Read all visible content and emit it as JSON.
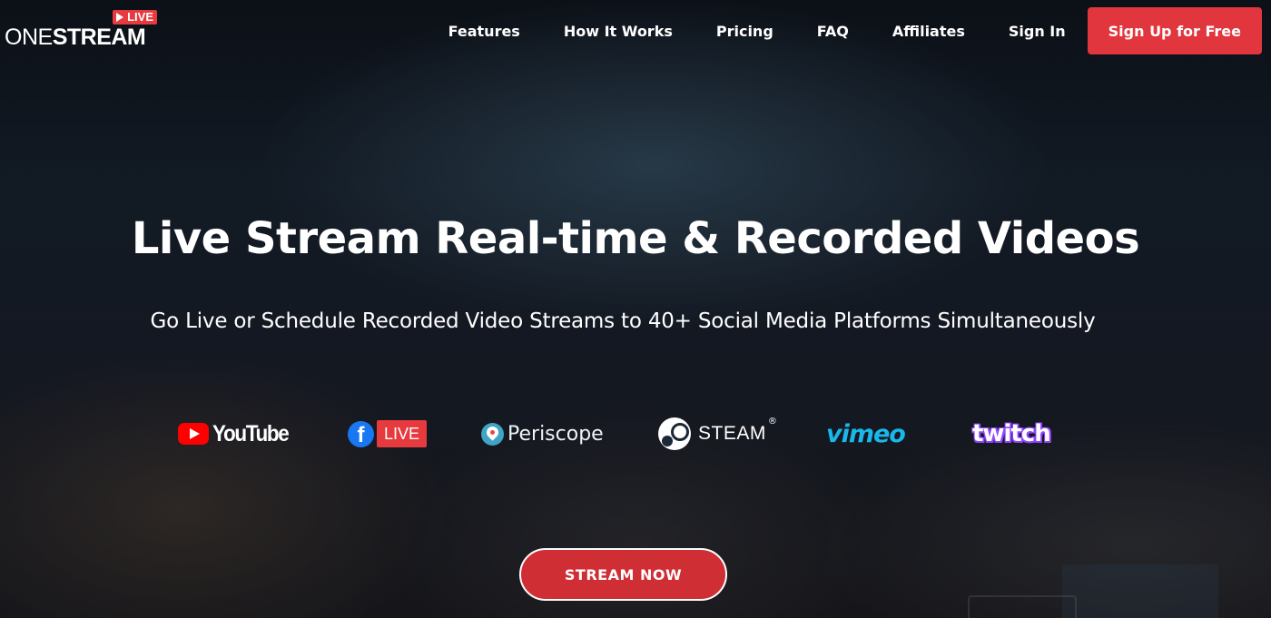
{
  "header": {
    "logo": {
      "badge": "LIVE",
      "word_one": "ONE",
      "word_stream": "STREAM"
    },
    "nav": [
      {
        "label": "Features"
      },
      {
        "label": "How It Works"
      },
      {
        "label": "Pricing"
      },
      {
        "label": "FAQ"
      },
      {
        "label": "Affiliates"
      },
      {
        "label": "Sign In"
      }
    ],
    "signup_label": "Sign Up for Free"
  },
  "hero": {
    "title": "Live Stream Real-time & Recorded Videos",
    "subtitle": "Go Live or Schedule Recorded Video Streams to 40+ Social Media Platforms Simultaneously"
  },
  "platforms": {
    "youtube": {
      "icon": "youtube-play-icon",
      "label": "YouTube"
    },
    "facebook": {
      "icon": "facebook-icon",
      "icon_glyph": "f",
      "label": "LIVE"
    },
    "periscope": {
      "icon": "periscope-icon",
      "label": "Periscope"
    },
    "steam": {
      "icon": "steam-icon",
      "label": "STEAM",
      "reg": "®"
    },
    "vimeo": {
      "label": "vimeo"
    },
    "twitch": {
      "label": "twitch"
    }
  },
  "cta": {
    "label": "STREAM NOW"
  },
  "colors": {
    "accent_red": "#e1363d",
    "vimeo_blue": "#1ab7ea",
    "twitch_purple": "#9146ff",
    "facebook_blue": "#1877f2",
    "youtube_red": "#ff0000",
    "periscope_teal": "#40a4c4"
  }
}
